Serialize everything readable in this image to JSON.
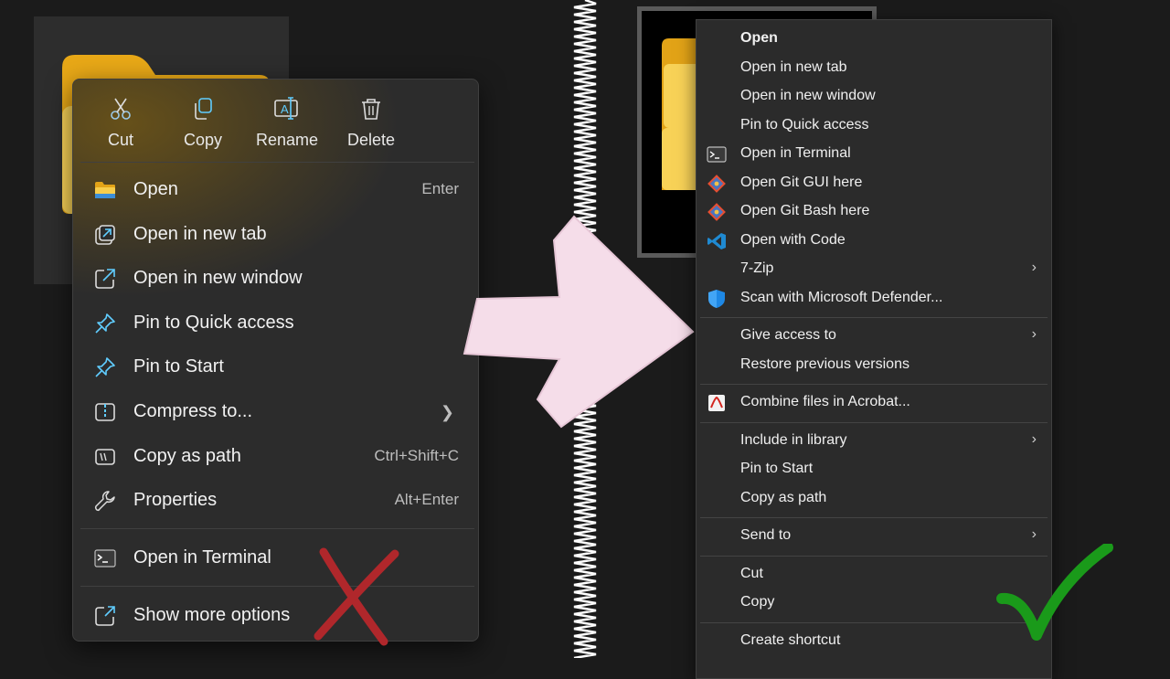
{
  "left_menu": {
    "commands": [
      {
        "label": "Cut",
        "icon": "scissors-icon"
      },
      {
        "label": "Copy",
        "icon": "copy-icon"
      },
      {
        "label": "Rename",
        "icon": "rename-icon"
      },
      {
        "label": "Delete",
        "icon": "trash-icon"
      }
    ],
    "items": [
      {
        "label": "Open",
        "shortcut": "Enter",
        "icon": "folder-icon"
      },
      {
        "label": "Open in new tab",
        "shortcut": "",
        "icon": "new-tab-icon"
      },
      {
        "label": "Open in new window",
        "shortcut": "",
        "icon": "new-window-icon"
      },
      {
        "label": "Pin to Quick access",
        "shortcut": "",
        "icon": "pin-icon"
      },
      {
        "label": "Pin to Start",
        "shortcut": "",
        "icon": "pin-icon"
      },
      {
        "label": "Compress to...",
        "shortcut": "",
        "icon": "zip-icon",
        "submenu": true
      },
      {
        "label": "Copy as path",
        "shortcut": "Ctrl+Shift+C",
        "icon": "path-icon"
      },
      {
        "label": "Properties",
        "shortcut": "Alt+Enter",
        "icon": "wrench-icon"
      }
    ],
    "terminal": {
      "label": "Open in Terminal",
      "icon": "terminal-icon"
    },
    "more": {
      "label": "Show more options",
      "icon": "more-options-icon"
    }
  },
  "right_menu": {
    "groups": [
      [
        {
          "label": "Open",
          "bold": true,
          "icon": ""
        },
        {
          "label": "Open in new tab",
          "icon": ""
        },
        {
          "label": "Open in new window",
          "icon": ""
        },
        {
          "label": "Pin to Quick access",
          "icon": ""
        },
        {
          "label": "Open in Terminal",
          "icon": "terminal-icon"
        },
        {
          "label": "Open Git GUI here",
          "icon": "git-icon"
        },
        {
          "label": "Open Git Bash here",
          "icon": "git-icon"
        },
        {
          "label": "Open with Code",
          "icon": "vscode-icon"
        },
        {
          "label": "7-Zip",
          "icon": "",
          "submenu": true
        },
        {
          "label": "Scan with Microsoft Defender...",
          "icon": "defender-shield-icon"
        }
      ],
      [
        {
          "label": "Give access to",
          "icon": "",
          "submenu": true
        },
        {
          "label": "Restore previous versions",
          "icon": ""
        }
      ],
      [
        {
          "label": "Combine files in Acrobat...",
          "icon": "acrobat-icon"
        }
      ],
      [
        {
          "label": "Include in library",
          "icon": "",
          "submenu": true
        },
        {
          "label": "Pin to Start",
          "icon": ""
        },
        {
          "label": "Copy as path",
          "icon": ""
        }
      ],
      [
        {
          "label": "Send to",
          "icon": "",
          "submenu": true
        }
      ],
      [
        {
          "label": "Cut",
          "icon": ""
        },
        {
          "label": "Copy",
          "icon": ""
        }
      ],
      [
        {
          "label": "Create shortcut",
          "icon": ""
        }
      ]
    ]
  },
  "colors": {
    "accent_blue": "#60cdff",
    "folder_yellow": "#f6c744",
    "cross_red": "#b0272b",
    "check_green": "#1a9a1a",
    "arrow_pink": "#f5dde9"
  }
}
